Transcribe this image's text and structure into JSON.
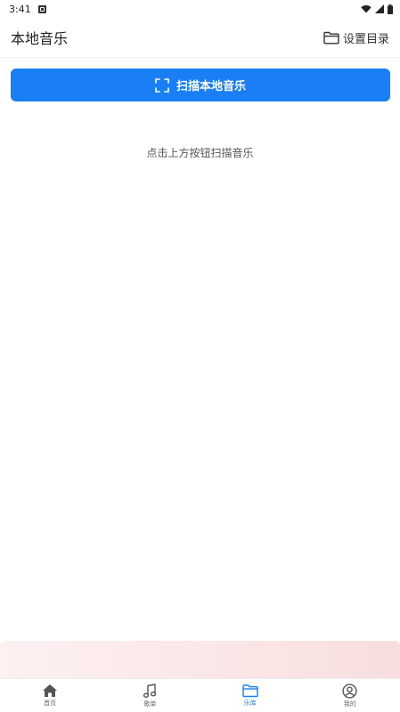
{
  "status_bar": {
    "time": "3:41",
    "icons": [
      "app-notification-icon",
      "wifi-icon",
      "cellular-signal-icon",
      "battery-icon"
    ]
  },
  "header": {
    "title": "本地音乐",
    "set_dir_label": "设置目录",
    "set_dir_icon": "folder-icon"
  },
  "scan_button": {
    "label": "扫描本地音乐",
    "icon": "scan-frame-icon",
    "color": "#1a7ef5"
  },
  "hint": "点击上方按钮扫描音乐",
  "bottom_nav": {
    "accent": "#1a7ef5",
    "items": [
      {
        "label": "首页",
        "icon": "home-icon",
        "active": false
      },
      {
        "label": "歌单",
        "icon": "music-note-icon",
        "active": false
      },
      {
        "label": "乐库",
        "icon": "folder-icon",
        "active": true
      },
      {
        "label": "我的",
        "icon": "user-icon",
        "active": false
      }
    ]
  }
}
